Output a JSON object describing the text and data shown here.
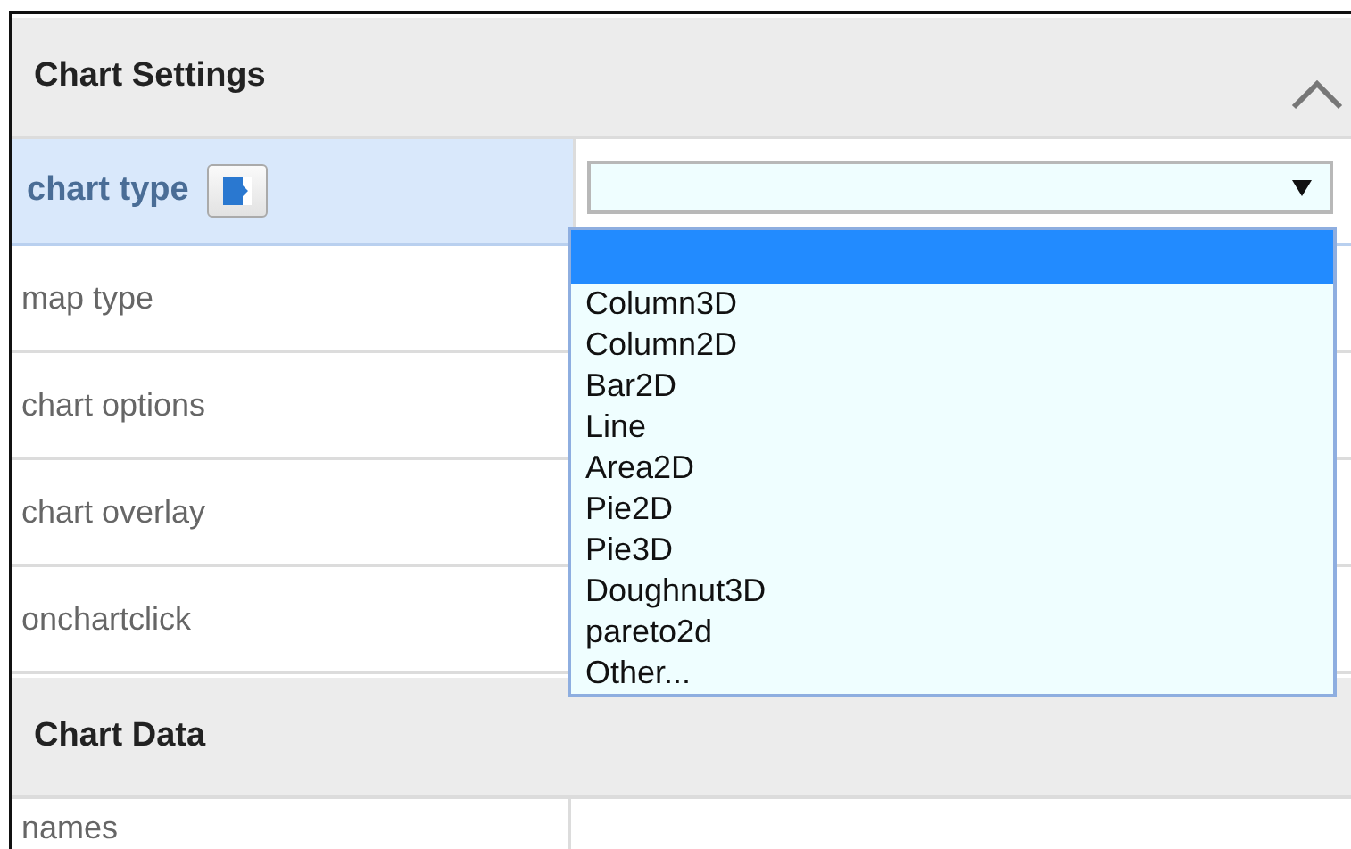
{
  "sections": [
    {
      "title": "Chart Settings",
      "expanded": true,
      "rows": [
        {
          "label": "chart type",
          "selected": true,
          "kind": "select"
        },
        {
          "label": "map type",
          "selected": false
        },
        {
          "label": "chart options",
          "selected": false
        },
        {
          "label": "chart overlay",
          "selected": false
        },
        {
          "label": "onchartclick",
          "selected": false
        }
      ]
    },
    {
      "title": "Chart Data",
      "rows": [
        {
          "label": "names",
          "selected": false
        }
      ]
    }
  ],
  "dropdown": {
    "options": [
      {
        "selected": true
      },
      {
        "label": "Column3D",
        "selected": false
      },
      {
        "label": "Column2D",
        "selected": false
      },
      {
        "label": "Bar2D",
        "selected": false
      },
      {
        "label": "Line",
        "selected": false
      },
      {
        "label": "Area2D",
        "selected": false
      },
      {
        "label": "Pie2D",
        "selected": false
      },
      {
        "label": "Pie3D",
        "selected": false
      },
      {
        "label": "Doughnut3D",
        "selected": false
      },
      {
        "label": "pareto2d",
        "selected": false
      },
      {
        "label": "Other...",
        "selected": false
      }
    ]
  }
}
